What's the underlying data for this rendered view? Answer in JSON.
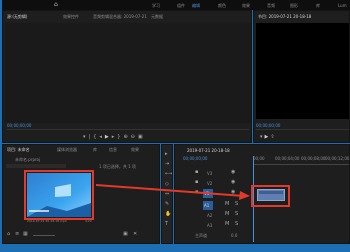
{
  "app": {
    "menu_items": [
      "学习",
      "组件",
      "编辑",
      "颜色",
      "效果",
      "音频",
      "图形",
      "库"
    ],
    "active_menu": "编辑",
    "right_menu": "Lum"
  },
  "source_panel": {
    "tabs": [
      "源:(无剪辑)",
      "效果控件",
      "音频剪辑混合器: 2019-07-21",
      "元数据"
    ],
    "timecode": "00;00;00;00",
    "right_timecode": "00;00;00;00"
  },
  "program_panel": {
    "title": "节目: 2019-07-21 20-18-18",
    "timecode": "00;00;00;00",
    "page": "1/2",
    "right_timecode": "00;00;00;00"
  },
  "project_panel": {
    "tabs": [
      "项目: 未命名",
      "媒体浏览器",
      "库",
      "信息",
      "效果"
    ],
    "project_name": "未命名.prproj",
    "item_count": "1 项已选择，共 1 项",
    "clip_name": "2019-07-21 20-18-18.mp4",
    "clip_duration": "4;22"
  },
  "timeline": {
    "title": "2019-07-21 20-18-18",
    "timecode": "00;00;00;00",
    "ruler_marks": [
      "00;00",
      "00;00;04;00",
      "00;00;08;00",
      "00;00;12;00"
    ],
    "tracks": [
      "V3",
      "V2",
      "V1",
      "A1",
      "A2",
      "A3"
    ],
    "master_label": "主声道",
    "master_value": "0.0"
  },
  "annotation": {
    "box_color": "#e23a2a",
    "arrow_color": "#e23a2a"
  }
}
